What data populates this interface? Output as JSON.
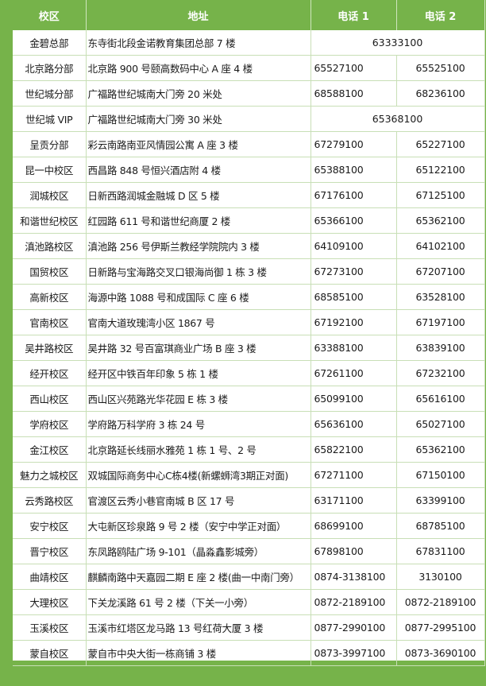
{
  "header": {
    "campus": "校区",
    "address": "地址",
    "phone1": "电话 1",
    "phone2": "电话 2"
  },
  "rows": [
    {
      "campus": "金碧总部",
      "address": "东寺街北段金诺教育集团总部 7 楼",
      "phone1": "63333100",
      "phone2": ""
    },
    {
      "campus": "北京路分部",
      "address": "北京路 900 号颐高数码中心 A 座 4 楼",
      "phone1": "65527100",
      "phone2": "65525100"
    },
    {
      "campus": "世纪城分部",
      "address": "广福路世纪城南大门旁 20 米处",
      "phone1": "68588100",
      "phone2": "68236100"
    },
    {
      "campus": "世纪城 VIP",
      "address": "广福路世纪城南大门旁 30 米处",
      "phone1": "65368100",
      "phone2": ""
    },
    {
      "campus": "呈贡分部",
      "address": "彩云南路南亚风情园公寓 A 座 3 楼",
      "phone1": "67279100",
      "phone2": "65227100"
    },
    {
      "campus": "昆一中校区",
      "address": "西昌路 848 号恒兴酒店附 4 楼",
      "phone1": "65388100",
      "phone2": "65122100"
    },
    {
      "campus": "润城校区",
      "address": "日新西路润城金融城 D 区 5 楼",
      "phone1": "67176100",
      "phone2": "67125100"
    },
    {
      "campus": "和谐世纪校区",
      "address": "红园路 611 号和谐世纪商厦 2 楼",
      "phone1": "65366100",
      "phone2": "65362100"
    },
    {
      "campus": "滇池路校区",
      "address": "滇池路 256 号伊斯兰教经学院院内 3 楼",
      "phone1": "64109100",
      "phone2": "64102100"
    },
    {
      "campus": "国贸校区",
      "address": "日新路与宝海路交叉口银海尚御 1 栋 3 楼",
      "phone1": "67273100",
      "phone2": "67207100"
    },
    {
      "campus": "高新校区",
      "address": "海源中路 1088 号和成国际 C 座 6 楼",
      "phone1": "68585100",
      "phone2": "63528100"
    },
    {
      "campus": "官南校区",
      "address": "官南大道玫瑰湾小区 1867 号",
      "phone1": "67192100",
      "phone2": "67197100"
    },
    {
      "campus": "吴井路校区",
      "address": "吴井路 32 号百富琪商业广场 B 座 3 楼",
      "phone1": "63388100",
      "phone2": "63839100"
    },
    {
      "campus": "经开校区",
      "address": "经开区中铁百年印象 5 栋 1 楼",
      "phone1": "67261100",
      "phone2": "67232100"
    },
    {
      "campus": "西山校区",
      "address": "西山区兴苑路光华花园 E 栋 3 楼",
      "phone1": "65099100",
      "phone2": "65616100"
    },
    {
      "campus": "学府校区",
      "address": "学府路万科学府 3 栋 24 号",
      "phone1": "65636100",
      "phone2": "65027100"
    },
    {
      "campus": "金江校区",
      "address": "北京路延长线丽水雅苑 1 栋 1 号、2 号",
      "phone1": "65822100",
      "phone2": "65362100"
    },
    {
      "campus": "魅力之城校区",
      "address": "双城国际商务中心C栋4楼(新螺蛳湾3期正对面)",
      "phone1": "67271100",
      "phone2": "67150100"
    },
    {
      "campus": "云秀路校区",
      "address": "官渡区云秀小巷官南城 B 区 17 号",
      "phone1": "63171100",
      "phone2": "63399100"
    },
    {
      "campus": "安宁校区",
      "address": "大屯新区珍泉路 9 号 2 楼（安宁中学正对面）",
      "phone1": "68699100",
      "phone2": "68785100"
    },
    {
      "campus": "晋宁校区",
      "address": "东凤路鸥陆广场 9-101（晶淼鑫影城旁）",
      "phone1": "67898100",
      "phone2": "67831100"
    },
    {
      "campus": "曲靖校区",
      "address": "麒麟南路中天嘉园二期 E 座 2 楼(曲一中南门旁）",
      "phone1": "0874-3138100",
      "phone2": "3130100"
    },
    {
      "campus": "大理校区",
      "address": "下关龙溪路 61 号 2 楼（下关一小旁）",
      "phone1": "0872-2189100",
      "phone2": "0872-2189100"
    },
    {
      "campus": "玉溪校区",
      "address": "玉溪市红塔区龙马路 13 号红荷大厦 3 楼",
      "phone1": "0877-2990100",
      "phone2": "0877-2995100"
    },
    {
      "campus": "蒙自校区",
      "address": "蒙自市中央大街一栋商铺 3 楼",
      "phone1": "0873-3997100",
      "phone2": "0873-3690100"
    }
  ],
  "colors": {
    "header_bg": "#76b34a",
    "header_text": "#ffffff",
    "grid": "#c8dfb6"
  }
}
